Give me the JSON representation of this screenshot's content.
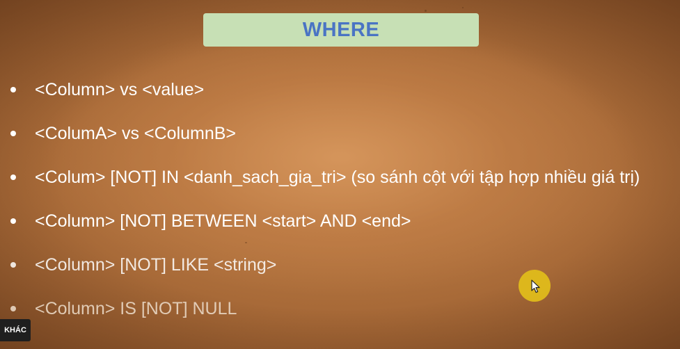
{
  "slide": {
    "title": "WHERE",
    "bullets": [
      "<Column> vs <value>",
      "<ColumA> vs <ColumnB>",
      "<Colum> [NOT] IN <danh_sach_gia_tri> (so sánh cột với tập hợp nhiều giá trị)",
      "<Column> [NOT] BETWEEN <start> AND <end>",
      "<Column> [NOT] LIKE <string>",
      "<Column> IS [NOT] NULL"
    ]
  },
  "overlay": {
    "badge_label": "KHÁC",
    "cursor_icon": "mouse-pointer-icon",
    "cursor_highlight_color": "#e2be1a"
  },
  "colors": {
    "title_background": "#c7e0b5",
    "title_text": "#4a74c4",
    "bullet_text": "#ffffff"
  }
}
